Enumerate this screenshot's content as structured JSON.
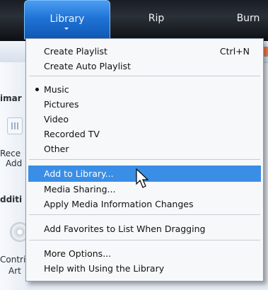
{
  "tabs": [
    {
      "label": "Library"
    },
    {
      "label": "Rip"
    },
    {
      "label": "Burn"
    }
  ],
  "background_text": {
    "prima": "imar",
    "rece": "Rece",
    "add": "Add",
    "additi": "dditi",
    "contri": "Contri",
    "art": "Art"
  },
  "menu": {
    "items": [
      {
        "label": "Create Playlist",
        "shortcut": "Ctrl+N"
      },
      {
        "label": "Create Auto Playlist"
      },
      {
        "label": "Music",
        "checked": true
      },
      {
        "label": "Pictures"
      },
      {
        "label": "Video"
      },
      {
        "label": "Recorded TV"
      },
      {
        "label": "Other"
      },
      {
        "label": "Add to Library...",
        "highlighted": true
      },
      {
        "label": "Media Sharing..."
      },
      {
        "label": "Apply Media Information Changes"
      },
      {
        "label": "Add Favorites to List When Dragging"
      },
      {
        "label": "More Options..."
      },
      {
        "label": "Help with Using the Library"
      }
    ]
  },
  "colors": {
    "highlight": "#3a8ee6",
    "active_tab": "#1f73d6"
  },
  "icons": [
    "grid-icon",
    "disc-icon",
    "mouse-cursor-icon",
    "bullet-icon"
  ]
}
